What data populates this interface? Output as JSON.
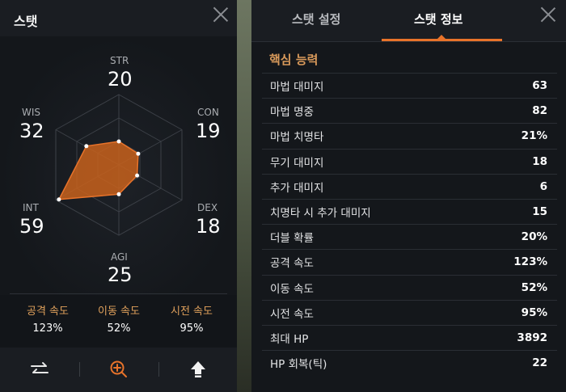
{
  "left_panel": {
    "title": "스탯",
    "stats": {
      "str": {
        "label": "STR",
        "value": "20"
      },
      "con": {
        "label": "CON",
        "value": "19"
      },
      "dex": {
        "label": "DEX",
        "value": "18"
      },
      "agi": {
        "label": "AGI",
        "value": "25"
      },
      "int": {
        "label": "INT",
        "value": "59"
      },
      "wis": {
        "label": "WIS",
        "value": "32"
      }
    },
    "speeds": [
      {
        "label": "공격 속도",
        "value": "123%"
      },
      {
        "label": "이동 속도",
        "value": "52%"
      },
      {
        "label": "시전 속도",
        "value": "95%"
      }
    ],
    "footer_icons": [
      "swap-arrows-icon",
      "zoom-plus-icon",
      "upload-arrow-icon"
    ],
    "accent_color": "#e8732a",
    "radar_fill_color": "#c8621c"
  },
  "right_panel": {
    "tabs": [
      {
        "label": "스탯 설정",
        "active": false
      },
      {
        "label": "스탯 정보",
        "active": true
      }
    ],
    "section_title": "핵심 능력",
    "rows": [
      {
        "label": "마법 대미지",
        "value": "63"
      },
      {
        "label": "마법 명중",
        "value": "82"
      },
      {
        "label": "마법 치명타",
        "value": "21%"
      },
      {
        "label": "무기 대미지",
        "value": "18"
      },
      {
        "label": "추가 대미지",
        "value": "6"
      },
      {
        "label": "치명타 시 추가 대미지",
        "value": "15"
      },
      {
        "label": "더블 확률",
        "value": "20%"
      },
      {
        "label": "공격 속도",
        "value": "123%"
      },
      {
        "label": "이동 속도",
        "value": "52%"
      },
      {
        "label": "시전 속도",
        "value": "95%"
      },
      {
        "label": "최대 HP",
        "value": "3892"
      },
      {
        "label": "HP 회복(틱)",
        "value": "22"
      }
    ]
  }
}
